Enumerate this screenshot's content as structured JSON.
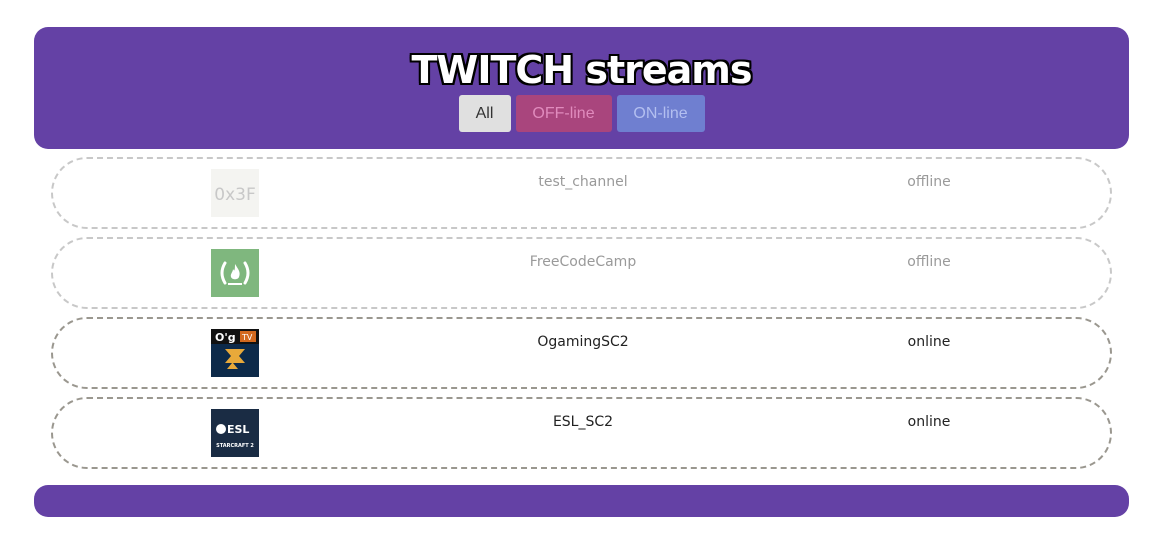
{
  "header": {
    "title": "TWITCH streams",
    "filters": [
      {
        "label": "All"
      },
      {
        "label": "OFF-line"
      },
      {
        "label": "ON-line"
      }
    ]
  },
  "channels": [
    {
      "name": "test_channel",
      "status": "offline",
      "logo_text": "0x3F",
      "logo": "placeholder-logo"
    },
    {
      "name": "FreeCodeCamp",
      "status": "offline",
      "logo": "freecodecamp-logo"
    },
    {
      "name": "OgamingSC2",
      "status": "online",
      "logo": "ogaming-logo"
    },
    {
      "name": "ESL_SC2",
      "status": "online",
      "logo": "esl-logo"
    }
  ],
  "colors": {
    "brand": "#6441a5",
    "all_button": "#e0e0e0",
    "offline_button": "#a9457d",
    "online_button": "#6f7fd0"
  }
}
